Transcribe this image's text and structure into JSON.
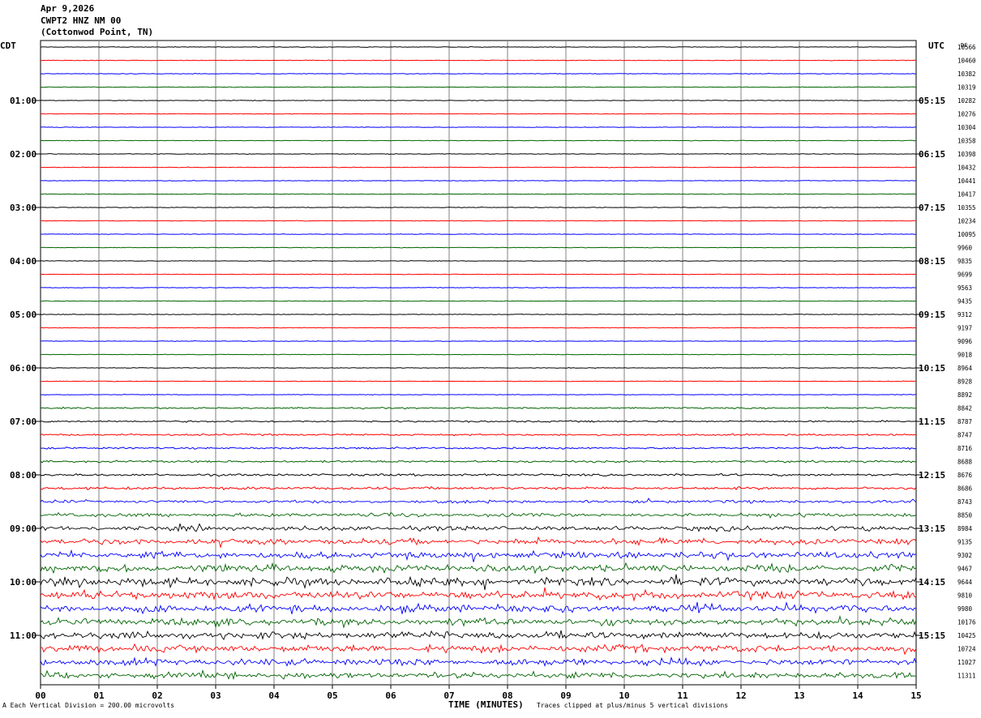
{
  "header": {
    "date": "Apr 9,2026",
    "station": "CWPT2 HNZ NM 00",
    "location": "(Cottonwod Point, TN)"
  },
  "left_zone": "CDT",
  "right_zone": "UTC",
  "dc_header": "DC",
  "footer": {
    "left": "Each Vertical Division =  200.00 microvolts",
    "center": "TIME (MINUTES)",
    "right": "Traces clipped at plus/minus 5 vertical divisions",
    "corner_mark": "A"
  },
  "colors": {
    "cycle": [
      "#000000",
      "#ff0000",
      "#0000ff",
      "#006400"
    ],
    "grid": "#808080"
  },
  "chart_data": {
    "type": "line",
    "xlabel": "TIME (MINUTES)",
    "x_ticks": [
      "00",
      "01",
      "02",
      "03",
      "04",
      "05",
      "06",
      "07",
      "08",
      "09",
      "10",
      "11",
      "12",
      "13",
      "14",
      "15"
    ],
    "xlim": [
      0,
      15
    ],
    "left_time_labels": [
      "01:00",
      "02:00",
      "03:00",
      "04:00",
      "05:00",
      "06:00",
      "07:00",
      "08:00",
      "09:00",
      "10:00",
      "11:00"
    ],
    "right_time_labels": [
      "05:15",
      "06:15",
      "07:15",
      "08:15",
      "09:15",
      "10:15",
      "11:15",
      "12:15",
      "13:15",
      "14:15",
      "15:15"
    ],
    "trace_dc_values": [
      "10566",
      "10460",
      "10382",
      "10319",
      "10282",
      "10276",
      "10304",
      "10358",
      "10398",
      "10432",
      "10441",
      "10417",
      "10355",
      "10234",
      "10095",
      "9960",
      "9835",
      "9699",
      "9563",
      "9435",
      "9312",
      "9197",
      "9096",
      "9018",
      "8964",
      "8928",
      "8892",
      "8842",
      "8787",
      "8747",
      "8716",
      "8688",
      "8676",
      "8686",
      "8743",
      "8850",
      "8984",
      "9135",
      "9302",
      "9467",
      "9644",
      "9810",
      "9980",
      "10176",
      "10425",
      "10724",
      "11027",
      "11311"
    ],
    "trace_activity": [
      1,
      1,
      1,
      1,
      1,
      1,
      1,
      1,
      1,
      1,
      1,
      1,
      1,
      1,
      1,
      1,
      1,
      1,
      1,
      1,
      1,
      1,
      1,
      1,
      1.2,
      1.2,
      1.3,
      1.4,
      1.6,
      1.7,
      1.8,
      2,
      2.2,
      2.6,
      3.2,
      4,
      5,
      6.5,
      7.5,
      8.5,
      9,
      9,
      8.5,
      8,
      8,
      8,
      7.5,
      6.5
    ]
  }
}
